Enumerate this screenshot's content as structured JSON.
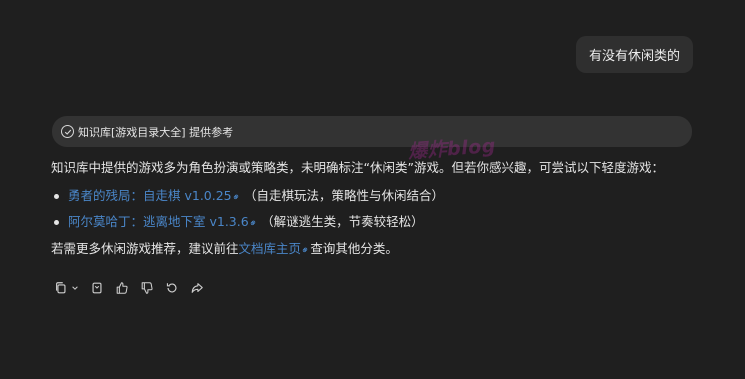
{
  "user_message": "有没有休闲类的",
  "source": {
    "label": "知识库[游戏目录大全] 提供参考"
  },
  "watermark": "爆炸blog",
  "answer": {
    "intro": "知识库中提供的游戏多为角色扮演或策略类，未明确标注“休闲类”游戏。但若你感兴趣，可尝试以下轻度游戏：",
    "items": [
      {
        "link": "勇者的残局：自走棋 v1.0.25",
        "note": "（自走棋玩法，策略性与休闲结合）"
      },
      {
        "link": "阿尔莫哈丁：逃离地下室 v1.3.6",
        "note": "（解谜逃生类，节奏较轻松）"
      }
    ],
    "outro_prefix": "若需更多休闲游戏推荐，建议前往",
    "outro_link": "文档库主页",
    "outro_suffix": "查询其他分类。"
  },
  "colors": {
    "background": "#1f1f1f",
    "bubble": "#2f2f2f",
    "link": "#4a86c8"
  },
  "icons": [
    "copy-icon",
    "chevron-down-icon",
    "bookmark-icon",
    "thumbs-up-icon",
    "thumbs-down-icon",
    "refresh-icon",
    "share-icon"
  ]
}
